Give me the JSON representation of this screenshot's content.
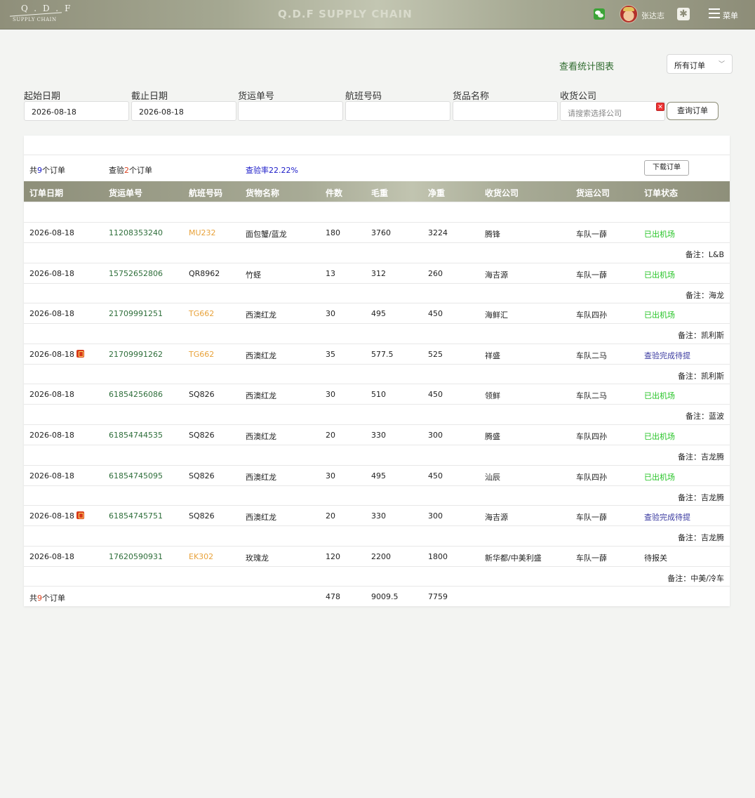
{
  "header": {
    "logo_main": "Q.D.F",
    "logo_sub": "SUPPLY CHAIN",
    "brand": "Q.D.F SUPPLY CHAIN",
    "username": "张达志",
    "menu_label": "菜单"
  },
  "toolbar": {
    "stats_link": "查看统计图表",
    "order_filter": "所有订单"
  },
  "filters": {
    "start_label": "起始日期",
    "start_value": "2026-08-18",
    "end_label": "截止日期",
    "end_value": "2026-08-18",
    "waybill_label": "货运单号",
    "flight_label": "航班号码",
    "goods_label": "货品名称",
    "company_label": "收货公司",
    "company_placeholder": "请搜索选择公司",
    "query_button": "查询订单"
  },
  "summary": {
    "total_prefix": "共",
    "total_count": "9",
    "total_suffix": "个订单",
    "inspected_prefix": "查验",
    "inspected_count": "2",
    "inspected_suffix": "个订单",
    "inspection_rate": "查验率22.22%",
    "download_button": "下载订单"
  },
  "table": {
    "headers": [
      "订单日期",
      "货运单号",
      "航班号码",
      "货物名称",
      "件数",
      "毛重",
      "净重",
      "收货公司",
      "货运公司",
      "订单状态"
    ],
    "rows": [
      {
        "date": "2026-08-18",
        "waybill": "11208353240",
        "flight": "MU232",
        "goods": "面包蟹/蓝龙",
        "pieces": "180",
        "gross": "3760",
        "net": "3224",
        "consignee": "腾锋",
        "carrier": "车队一薛",
        "status": "已出机场",
        "note": "备注：L&B"
      },
      {
        "date": "2026-08-18",
        "waybill": "15752652806",
        "flight": "QR8962",
        "goods": "竹蛏",
        "pieces": "13",
        "gross": "312",
        "net": "260",
        "consignee": "海吉源",
        "carrier": "车队一薛",
        "status": "已出机场",
        "note": "备注：海龙"
      },
      {
        "date": "2026-08-18",
        "waybill": "21709991251",
        "flight": "TG662",
        "goods": "西澳红龙",
        "pieces": "30",
        "gross": "495",
        "net": "450",
        "consignee": "海鲜汇",
        "carrier": "车队四孙",
        "status": "已出机场",
        "note": "备注：凯利斯"
      },
      {
        "date": "2026-08-18",
        "waybill": "21709991262",
        "flight": "TG662",
        "goods": "西澳红龙",
        "pieces": "35",
        "gross": "577.5",
        "net": "525",
        "consignee": "祥盛",
        "carrier": "车队二马",
        "status": "查验完成待提",
        "note": "备注：凯利斯"
      },
      {
        "date": "2026-08-18",
        "waybill": "61854256086",
        "flight": "SQ826",
        "goods": "西澳红龙",
        "pieces": "30",
        "gross": "510",
        "net": "450",
        "consignee": "领鲜",
        "carrier": "车队二马",
        "status": "已出机场",
        "note": "备注：蓝波"
      },
      {
        "date": "2026-08-18",
        "waybill": "61854744535",
        "flight": "SQ826",
        "goods": "西澳红龙",
        "pieces": "20",
        "gross": "330",
        "net": "300",
        "consignee": "腾盛",
        "carrier": "车队四孙",
        "status": "已出机场",
        "note": "备注：吉龙腾"
      },
      {
        "date": "2026-08-18",
        "waybill": "61854745095",
        "flight": "SQ826",
        "goods": "西澳红龙",
        "pieces": "30",
        "gross": "495",
        "net": "450",
        "consignee": "汕辰",
        "carrier": "车队四孙",
        "status": "已出机场",
        "note": "备注：吉龙腾"
      },
      {
        "date": "2026-08-18",
        "waybill": "61854745751",
        "flight": "SQ826",
        "goods": "西澳红龙",
        "pieces": "20",
        "gross": "330",
        "net": "300",
        "consignee": "海吉源",
        "carrier": "车队一薛",
        "status": "查验完成待提",
        "note": "备注：吉龙腾"
      },
      {
        "date": "2026-08-18",
        "waybill": "17620590931",
        "flight": "EK302",
        "goods": "玫瑰龙",
        "pieces": "120",
        "gross": "2200",
        "net": "1800",
        "consignee": "新华都/中美利盛",
        "carrier": "车队一薛",
        "status": "待报关",
        "note": "备注：中美/冷车"
      }
    ],
    "totals": {
      "prefix": "共",
      "count": "9",
      "suffix": "个订单",
      "pieces": "478",
      "gross": "9009.5",
      "net": "7759"
    }
  },
  "colors": {
    "waybill": "#2e6e3a",
    "flight_orange": "#e8a23a",
    "status_out": "#27c427",
    "status_inspected": "#3a3aa0",
    "count_highlight": "#d42"
  }
}
